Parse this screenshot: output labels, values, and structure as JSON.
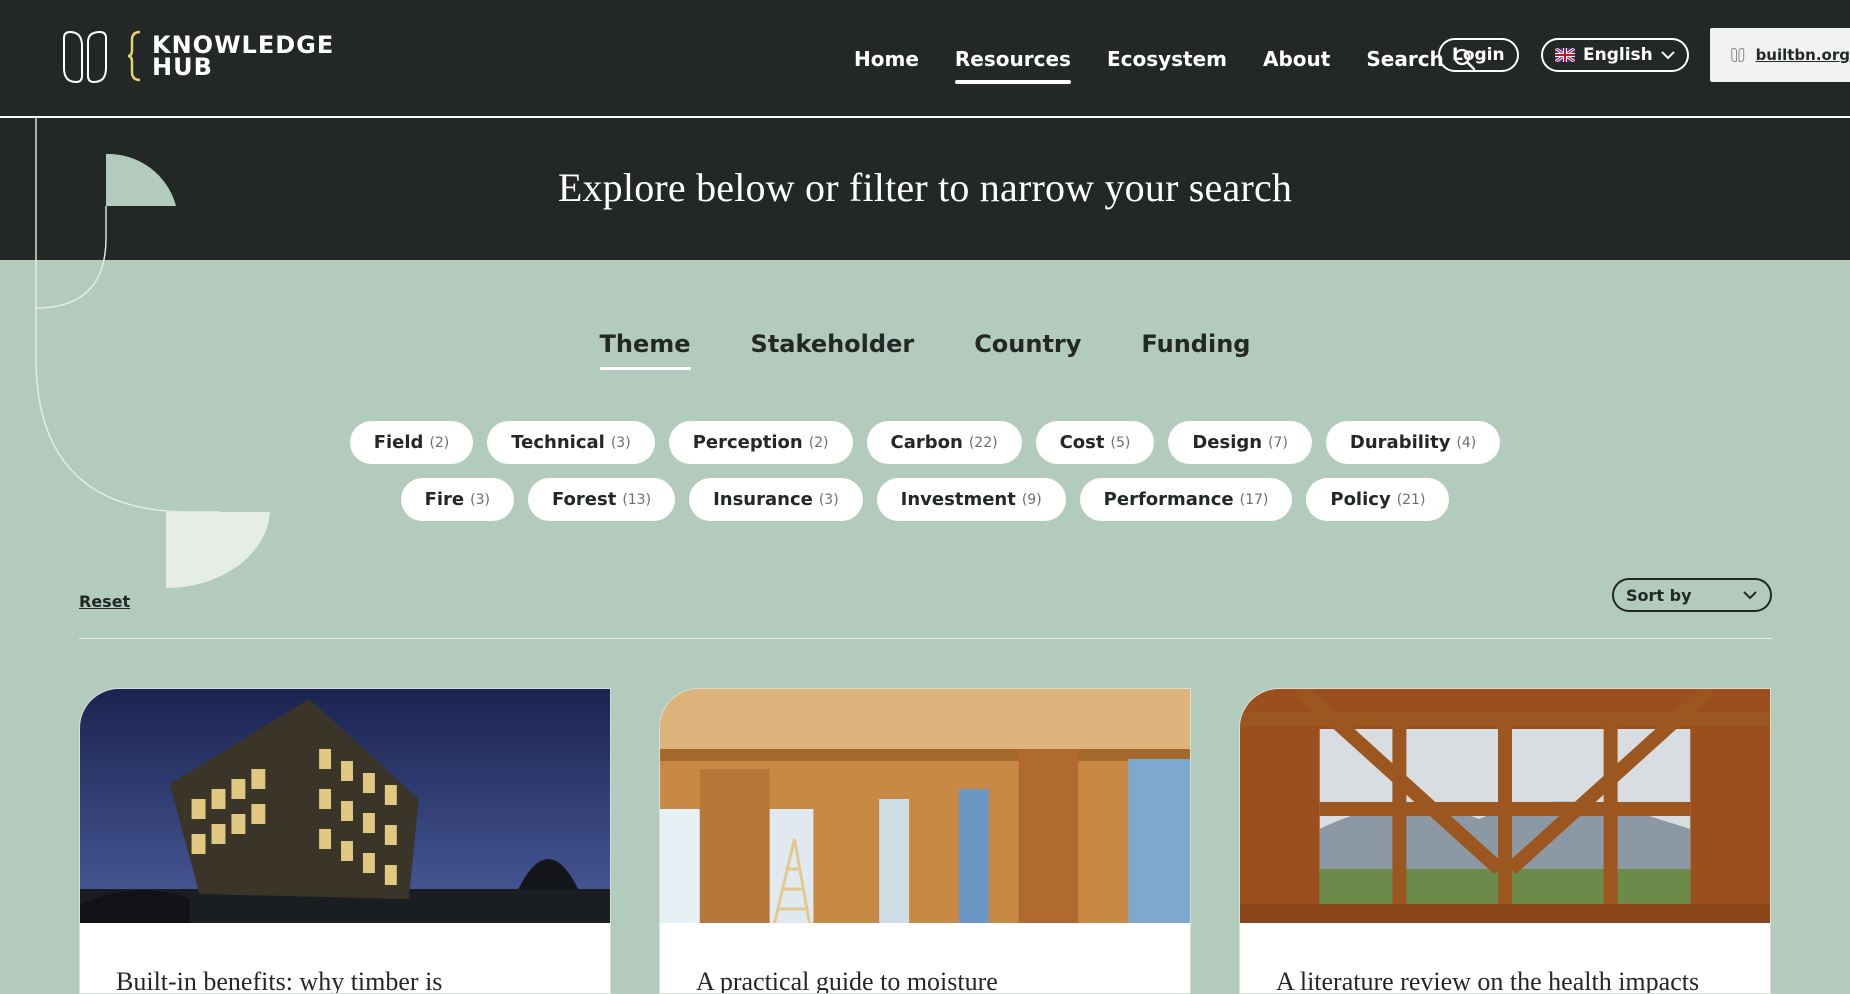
{
  "brand": {
    "name_line1": "KNOWLEDGE",
    "name_line2": "HUB"
  },
  "nav": {
    "items": [
      "Home",
      "Resources",
      "Ecosystem",
      "About",
      "Search"
    ],
    "active": "Resources",
    "login_label": "Login",
    "language_label": "English",
    "partner_label": "builtbn.org"
  },
  "hero": {
    "title": "Explore below or filter to narrow your search"
  },
  "tabs": {
    "items": [
      "Theme",
      "Stakeholder",
      "Country",
      "Funding"
    ],
    "active": "Theme"
  },
  "filters": {
    "row1": [
      {
        "label": "Field",
        "count": "(2)"
      },
      {
        "label": "Technical",
        "count": "(3)"
      },
      {
        "label": "Perception",
        "count": "(2)"
      },
      {
        "label": "Carbon",
        "count": "(22)"
      },
      {
        "label": "Cost",
        "count": "(5)"
      },
      {
        "label": "Design",
        "count": "(7)"
      },
      {
        "label": "Durability",
        "count": "(4)"
      }
    ],
    "row2": [
      {
        "label": "Fire",
        "count": "(3)"
      },
      {
        "label": "Forest",
        "count": "(13)"
      },
      {
        "label": "Insurance",
        "count": "(3)"
      },
      {
        "label": "Investment",
        "count": "(9)"
      },
      {
        "label": "Performance",
        "count": "(17)"
      },
      {
        "label": "Policy",
        "count": "(21)"
      }
    ]
  },
  "controls": {
    "reset_label": "Reset",
    "sort_label": "Sort by"
  },
  "cards": [
    {
      "title": "Built-in benefits: why timber is"
    },
    {
      "title": "A practical guide to moisture"
    },
    {
      "title": "A literature review on the health impacts"
    }
  ],
  "colors": {
    "dark": "#232725",
    "mint": "#b2cbbd",
    "accent_yellow": "#e8d16a"
  }
}
